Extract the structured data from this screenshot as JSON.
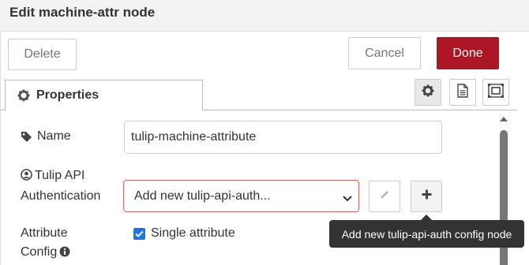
{
  "header": {
    "title": "Edit machine-attr node"
  },
  "actions": {
    "delete_label": "Delete",
    "cancel_label": "Cancel",
    "done_label": "Done"
  },
  "tabs": [
    {
      "label": "Properties",
      "icon": "gear-icon"
    }
  ],
  "tab_buttons": [
    "settings-icon",
    "description-icon",
    "appearance-icon"
  ],
  "form": {
    "name_label": "Name",
    "name_value": "tulip-machine-attribute",
    "auth_label_line1": "Tulip API",
    "auth_label_line2": "Authentication",
    "auth_selected": "Add new tulip-api-auth...",
    "attr_label_line1": "Attribute",
    "attr_label_line2": "Config",
    "single_attribute_label": "Single attribute",
    "single_attribute_checked": true
  },
  "tooltip": {
    "text": "Add new tulip-api-auth config node"
  },
  "colors": {
    "primary": "#ad1625",
    "checkbox": "#1a73e8",
    "error_border": "#d6615f"
  }
}
